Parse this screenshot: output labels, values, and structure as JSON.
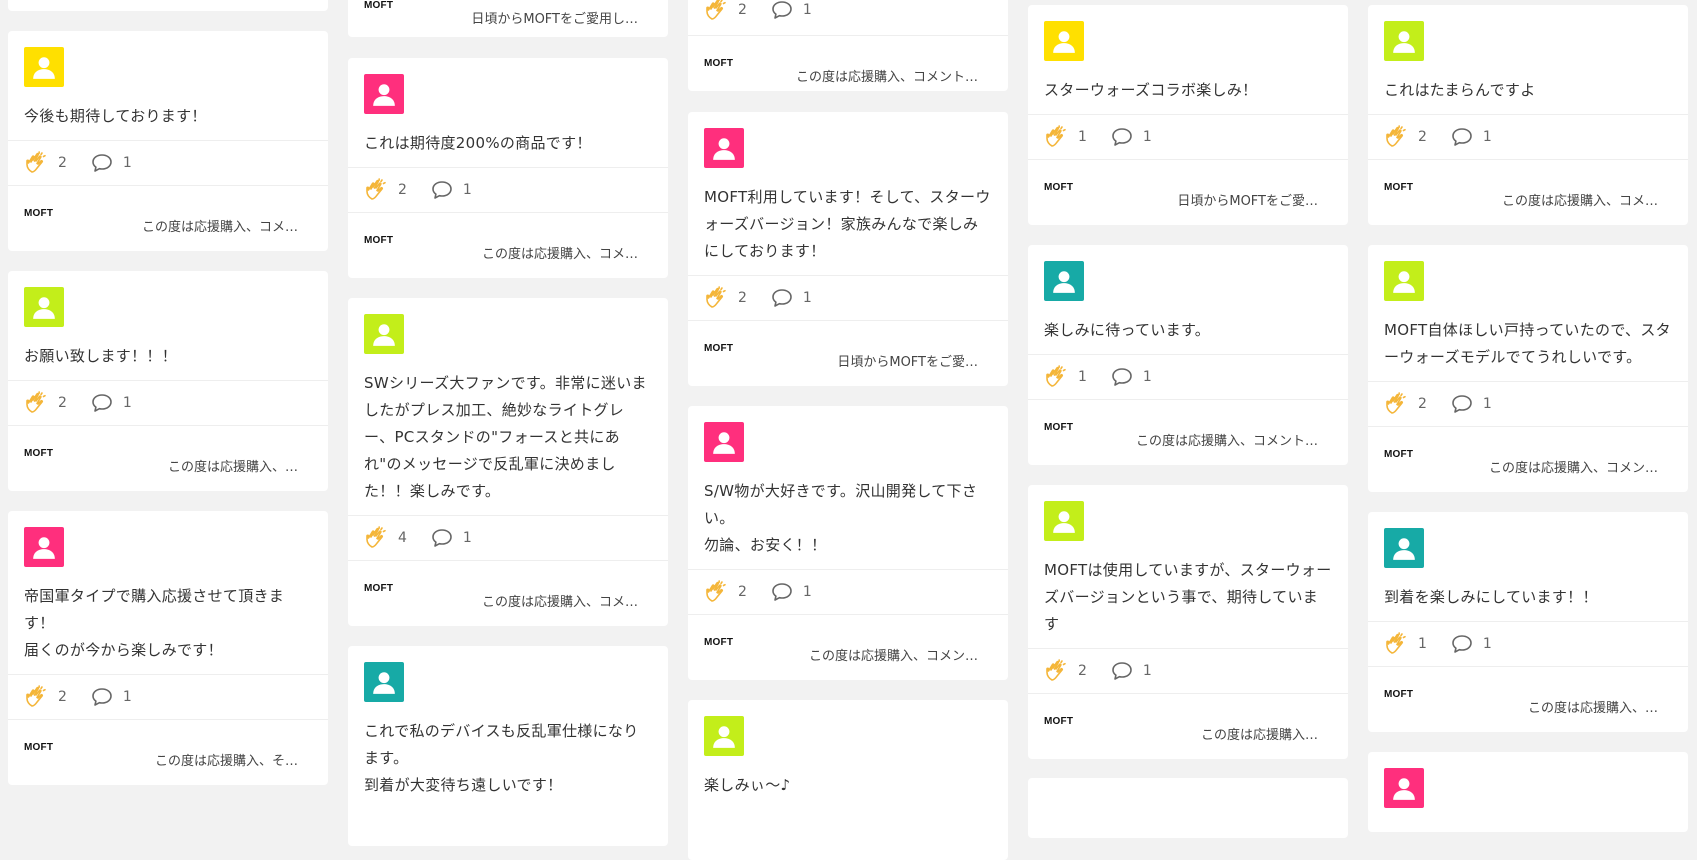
{
  "colors": {
    "yellow": "#ffe000",
    "lime": "#c3ee1a",
    "pink": "#ff2f7d",
    "teal": "#17aaa6",
    "clap": "#f4b63a"
  },
  "icons": {
    "avatar": "user-icon",
    "clap": "clap-icon",
    "comment": "speech-bubble-icon"
  },
  "brand": "MOFT",
  "columns": [
    {
      "cards": [
        {
          "avatar_color": "yellow",
          "comment": "今後も期待しております！",
          "claps": "2",
          "comments": "1",
          "reply": "この度は応援購入、コメ…"
        },
        {
          "avatar_color": "lime",
          "comment": "お願い致します！！！",
          "claps": "2",
          "comments": "1",
          "reply": "この度は応援購入、…"
        },
        {
          "avatar_color": "pink",
          "comment": "帝国軍タイプで購入応援させて頂きます！\n届くのが今から楽しみです！",
          "claps": "2",
          "comments": "1",
          "reply": "この度は応援購入、そ…"
        }
      ]
    },
    {
      "top_reply": "日頃からMOFTをご愛用し…",
      "cards": [
        {
          "avatar_color": "pink",
          "comment": "これは期待度200%の商品です！",
          "claps": "2",
          "comments": "1",
          "reply": "この度は応援購入、コメ…"
        },
        {
          "avatar_color": "lime",
          "comment": "SWシリーズ大ファンです。非常に迷いましたがプレス加工、絶妙なライトグレー、PCスタンドの\"フォースと共にあれ\"のメッセージで反乱軍に決めました！！楽しみです。",
          "claps": "4",
          "comments": "1",
          "reply": "この度は応援購入、コメ…"
        },
        {
          "avatar_color": "teal",
          "comment": "これで私のデバイスも反乱軍仕様になります。\n到着が大変待ち遠しいです！"
        }
      ]
    },
    {
      "top_stats": {
        "claps": "2",
        "comments": "1"
      },
      "top_reply": "この度は応援購入、コメント…",
      "cards": [
        {
          "avatar_color": "pink",
          "comment": "MOFT利用しています！そして、スターウォーズバージョン！家族みんなで楽しみにしております！",
          "claps": "2",
          "comments": "1",
          "reply": "日頃からMOFTをご愛…"
        },
        {
          "avatar_color": "pink",
          "comment": "S/W物が大好きです。沢山開発して下さい。\n勿論、お安く！！",
          "claps": "2",
          "comments": "1",
          "reply": "この度は応援購入、コメン…"
        },
        {
          "avatar_color": "lime",
          "comment": "楽しみぃ〜♪"
        }
      ]
    },
    {
      "cards": [
        {
          "avatar_color": "yellow",
          "comment": "スターウォーズコラボ楽しみ！",
          "claps": "1",
          "comments": "1",
          "reply": "日頃からMOFTをご愛…"
        },
        {
          "avatar_color": "teal",
          "comment": "楽しみに待っています。",
          "claps": "1",
          "comments": "1",
          "reply": "この度は応援購入、コメント…"
        },
        {
          "avatar_color": "lime",
          "comment": "MOFTは使用していますが、スターウォーズバージョンという事で、期待しています",
          "claps": "2",
          "comments": "1",
          "reply": "この度は応援購入…"
        }
      ]
    },
    {
      "cards": [
        {
          "avatar_color": "lime",
          "comment": "これはたまらんですよ",
          "claps": "2",
          "comments": "1",
          "reply": "この度は応援購入、コメ…"
        },
        {
          "avatar_color": "lime",
          "comment": "MOFT自体ほしい戸持っていたので、スターウォーズモデルでてうれしいです。",
          "claps": "2",
          "comments": "1",
          "reply": "この度は応援購入、コメン…"
        },
        {
          "avatar_color": "teal",
          "comment": "到着を楽しみにしています！！",
          "claps": "1",
          "comments": "1",
          "reply": "この度は応援購入、…"
        },
        {
          "avatar_color": "pink",
          "comment": ""
        }
      ]
    }
  ]
}
